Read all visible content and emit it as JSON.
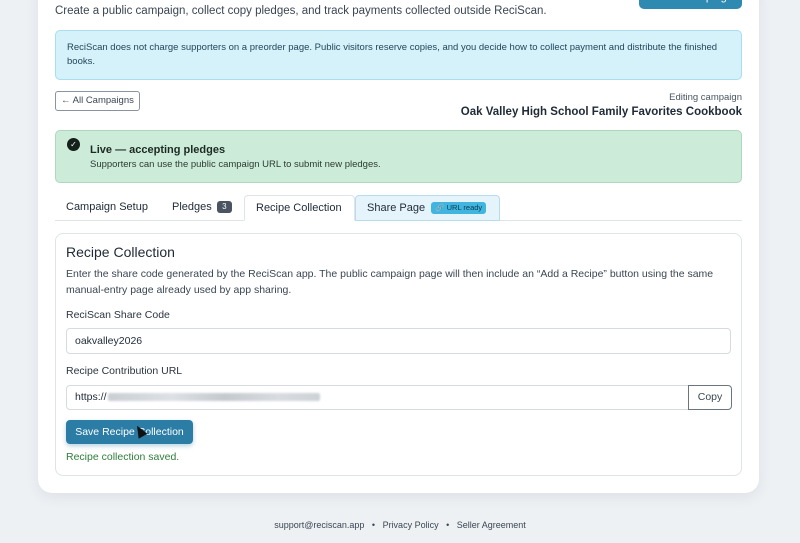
{
  "header": {
    "new_campaign_label": "+ New Campaign",
    "subtitle": "Create a public campaign, collect copy pledges, and track payments collected outside ReciScan."
  },
  "info": {
    "text": "ReciScan does not charge supporters on a preorder page. Public visitors reserve copies, and you decide how to collect payment and distribute the finished books."
  },
  "nav": {
    "back_label": "All Campaigns",
    "editing_label": "Editing campaign",
    "campaign_name": "Oak Valley High School Family Favorites Cookbook"
  },
  "status": {
    "title": "Live — accepting pledges",
    "description": "Supporters can use the public campaign URL to submit new pledges."
  },
  "tabs": {
    "setup": "Campaign Setup",
    "pledges": "Pledges",
    "pledges_count": "3",
    "recipe": "Recipe Collection",
    "share": "Share Page",
    "share_badge": "URL ready"
  },
  "panel": {
    "title": "Recipe Collection",
    "description": "Enter the share code generated by the ReciScan app. The public campaign page will then include an “Add a Recipe” button using the same manual-entry page already used by app sharing.",
    "share_code_label": "ReciScan Share Code",
    "share_code_value": "oakvalley2026",
    "url_label": "Recipe Contribution URL",
    "url_prefix": "https://",
    "copy_label": "Copy",
    "save_label": "Save Recipe Collection",
    "saved_message": "Recipe collection saved."
  },
  "footer": {
    "email": "support@reciscan.app",
    "privacy": "Privacy Policy",
    "agreement": "Seller Agreement",
    "separator": "•"
  }
}
